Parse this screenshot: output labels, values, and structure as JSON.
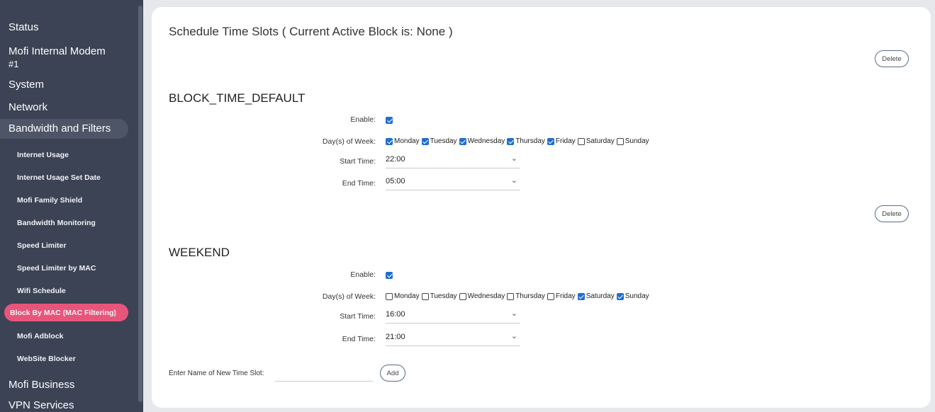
{
  "sidebar": {
    "top": [
      "Status",
      "Mofi Internal Modem",
      "#1",
      "System",
      "Network",
      "Bandwidth and Filters"
    ],
    "sub": [
      "Internet Usage",
      "Internet Usage Set Date",
      "Mofi Family Shield",
      "Bandwidth Monitoring",
      "Speed Limiter",
      "Speed Limiter by MAC",
      "Wifi Schedule",
      "Block By MAC (MAC Filtering)",
      "Mofi Adblock",
      "WebSite Blocker"
    ],
    "bottom": [
      "Mofi Business",
      "VPN Services"
    ],
    "colors": {
      "active_pink": "#e8557a",
      "bg": "#3b4354"
    }
  },
  "main": {
    "title": "Schedule Time Slots ( Current Active Block is: None )",
    "delete_label": "Delete",
    "labels": {
      "enable": "Enable:",
      "days": "Day(s) of Week:",
      "start": "Start Time:",
      "end": "End Time:"
    },
    "day_names": [
      "Monday",
      "Tuesday",
      "Wednesday",
      "Thursday",
      "Friday",
      "Saturday",
      "Sunday"
    ],
    "blocks": [
      {
        "name": "BLOCK_TIME_DEFAULT",
        "enabled": true,
        "days": [
          true,
          true,
          true,
          true,
          true,
          false,
          false
        ],
        "start": "22:00",
        "end": "05:00"
      },
      {
        "name": "WEEKEND",
        "enabled": true,
        "days": [
          false,
          false,
          false,
          false,
          false,
          true,
          true
        ],
        "start": "16:00",
        "end": "21:00"
      }
    ],
    "new_slot_label": "Enter Name of New Time Slot:",
    "new_slot_value": "",
    "add_label": "Add",
    "colors": {
      "checkbox_blue": "#1f6fcf"
    }
  }
}
